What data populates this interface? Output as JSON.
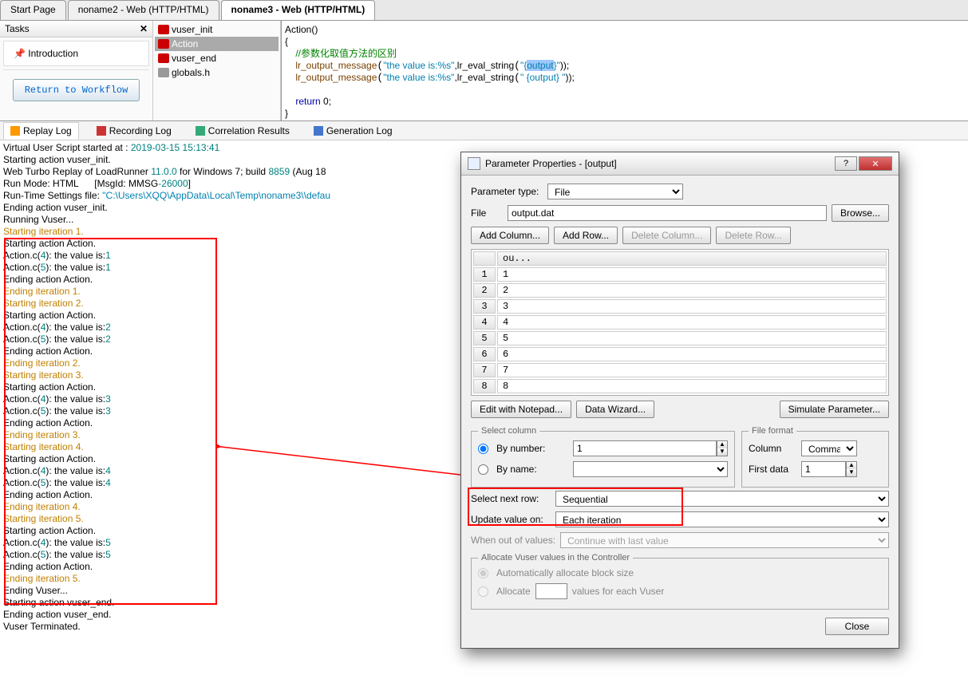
{
  "tabs": [
    "Start Page",
    "noname2 - Web (HTTP/HTML)",
    "noname3 - Web (HTTP/HTML)"
  ],
  "active_tab": 2,
  "tasks": {
    "title": "Tasks",
    "intro": "Introduction",
    "workflow_btn": "Return to Workflow"
  },
  "script_tree": {
    "items": [
      "vuser_init",
      "Action",
      "vuser_end",
      "globals.h"
    ],
    "selected": 1
  },
  "code": {
    "l1": "Action()",
    "l2": "{",
    "l3": "    //参数化取值方法的区别",
    "l4a": "    lr_output_message",
    "l4b": "\"the value is:%s\"",
    "l4c": ",lr_eval_string",
    "l4d": "\"{",
    "l4sel": "output",
    "l4e": "}\"",
    "l4f": "));",
    "l5a": "    lr_output_message",
    "l5b": "\"the value is:%s\"",
    "l5c": ",lr_eval_string",
    "l5d": "\" {output} \"",
    "l5e": "));",
    "l6": "",
    "l7": "    return",
    "l7b": " 0;",
    "l8": "}"
  },
  "logtabs": {
    "replay": "Replay Log",
    "recording": "Recording Log",
    "correlation": "Correlation Results",
    "generation": "Generation Log"
  },
  "log_lines": [
    {
      "t": "Virtual User Script started at : ",
      "c": "black",
      "a": "2019-03-15 15:13:41",
      "ac": "teal"
    },
    {
      "t": "Starting action vuser_init.",
      "c": "black"
    },
    {
      "t": "Web Turbo Replay of LoadRunner ",
      "c": "black",
      "a": "11.0.0",
      "ac": "teal",
      "b": " for Windows 7; build ",
      "bc": "black",
      "d": "8859",
      "dc": "teal",
      "e": " (Aug 18",
      "ec": "black"
    },
    {
      "t": "Run Mode: HTML      [MsgId: MMSG",
      "c": "black",
      "a": "-26000",
      "ac": "teal",
      "b": "]",
      "bc": "black"
    },
    {
      "t": "Run-Time Settings file: ",
      "c": "black",
      "a": "\"C:\\Users\\XQQ\\AppData\\Local\\Temp\\noname3\\\\defau",
      "ac": "path"
    },
    {
      "t": "Ending action vuser_init.",
      "c": "black"
    },
    {
      "t": "Running Vuser...",
      "c": "black"
    },
    {
      "t": "Starting iteration 1.",
      "c": "orange"
    },
    {
      "t": "Starting action Action.",
      "c": "black"
    },
    {
      "t": "Action.c(",
      "c": "black",
      "a": "4",
      "ac": "teal",
      "b": "): the value is:",
      "bc": "black",
      "d": "1",
      "dc": "teal"
    },
    {
      "t": "Action.c(",
      "c": "black",
      "a": "5",
      "ac": "teal",
      "b": "): the value is:",
      "bc": "black",
      "d": "1",
      "dc": "teal"
    },
    {
      "t": "Ending action Action.",
      "c": "black"
    },
    {
      "t": "Ending iteration 1.",
      "c": "orange"
    },
    {
      "t": "Starting iteration 2.",
      "c": "orange"
    },
    {
      "t": "Starting action Action.",
      "c": "black"
    },
    {
      "t": "Action.c(",
      "c": "black",
      "a": "4",
      "ac": "teal",
      "b": "): the value is:",
      "bc": "black",
      "d": "2",
      "dc": "teal"
    },
    {
      "t": "Action.c(",
      "c": "black",
      "a": "5",
      "ac": "teal",
      "b": "): the value is:",
      "bc": "black",
      "d": "2",
      "dc": "teal"
    },
    {
      "t": "Ending action Action.",
      "c": "black"
    },
    {
      "t": "Ending iteration 2.",
      "c": "orange"
    },
    {
      "t": "Starting iteration 3.",
      "c": "orange"
    },
    {
      "t": "Starting action Action.",
      "c": "black"
    },
    {
      "t": "Action.c(",
      "c": "black",
      "a": "4",
      "ac": "teal",
      "b": "): the value is:",
      "bc": "black",
      "d": "3",
      "dc": "teal"
    },
    {
      "t": "Action.c(",
      "c": "black",
      "a": "5",
      "ac": "teal",
      "b": "): the value is:",
      "bc": "black",
      "d": "3",
      "dc": "teal"
    },
    {
      "t": "Ending action Action.",
      "c": "black"
    },
    {
      "t": "Ending iteration 3.",
      "c": "orange"
    },
    {
      "t": "Starting iteration 4.",
      "c": "orange"
    },
    {
      "t": "Starting action Action.",
      "c": "black"
    },
    {
      "t": "Action.c(",
      "c": "black",
      "a": "4",
      "ac": "teal",
      "b": "): the value is:",
      "bc": "black",
      "d": "4",
      "dc": "teal"
    },
    {
      "t": "Action.c(",
      "c": "black",
      "a": "5",
      "ac": "teal",
      "b": "): the value is:",
      "bc": "black",
      "d": "4",
      "dc": "teal"
    },
    {
      "t": "Ending action Action.",
      "c": "black"
    },
    {
      "t": "Ending iteration 4.",
      "c": "orange"
    },
    {
      "t": "Starting iteration 5.",
      "c": "orange"
    },
    {
      "t": "Starting action Action.",
      "c": "black"
    },
    {
      "t": "Action.c(",
      "c": "black",
      "a": "4",
      "ac": "teal",
      "b": "): the value is:",
      "bc": "black",
      "d": "5",
      "dc": "teal"
    },
    {
      "t": "Action.c(",
      "c": "black",
      "a": "5",
      "ac": "teal",
      "b": "): the value is:",
      "bc": "black",
      "d": "5",
      "dc": "teal"
    },
    {
      "t": "Ending action Action.",
      "c": "black"
    },
    {
      "t": "Ending iteration 5.",
      "c": "orange"
    },
    {
      "t": "Ending Vuser...",
      "c": "black"
    },
    {
      "t": "Starting action vuser_end.",
      "c": "black"
    },
    {
      "t": "Ending action vuser_end.",
      "c": "black"
    },
    {
      "t": "Vuser Terminated.",
      "c": "black"
    }
  ],
  "dialog": {
    "title": "Parameter Properties - [output]",
    "param_type_label": "Parameter type:",
    "param_type_value": "File",
    "file_label": "File",
    "file_value": "output.dat",
    "browse": "Browse...",
    "add_col": "Add Column...",
    "add_row": "Add Row...",
    "del_col": "Delete Column...",
    "del_row": "Delete Row...",
    "grid_header": "ou...",
    "grid_rows": [
      "1",
      "2",
      "3",
      "4",
      "5",
      "6",
      "7",
      "8"
    ],
    "edit_notepad": "Edit with Notepad...",
    "data_wizard": "Data Wizard...",
    "simulate": "Simulate Parameter...",
    "select_column": "Select column",
    "by_number": "By number:",
    "by_number_val": "1",
    "by_name": "By name:",
    "file_format": "File format",
    "column_lbl": "Column",
    "column_val": "Comma",
    "first_data": "First data",
    "first_data_val": "1",
    "select_next_row": "Select next row:",
    "select_next_row_val": "Sequential",
    "update_value_on": "Update value on:",
    "update_value_on_val": "Each iteration",
    "when_out": "When out of values:",
    "when_out_val": "Continue with last value",
    "allocate_legend": "Allocate Vuser values in the Controller",
    "auto_alloc": "Automatically allocate block size",
    "alloc": "Allocate",
    "alloc_suffix": "values for each Vuser",
    "close": "Close"
  }
}
